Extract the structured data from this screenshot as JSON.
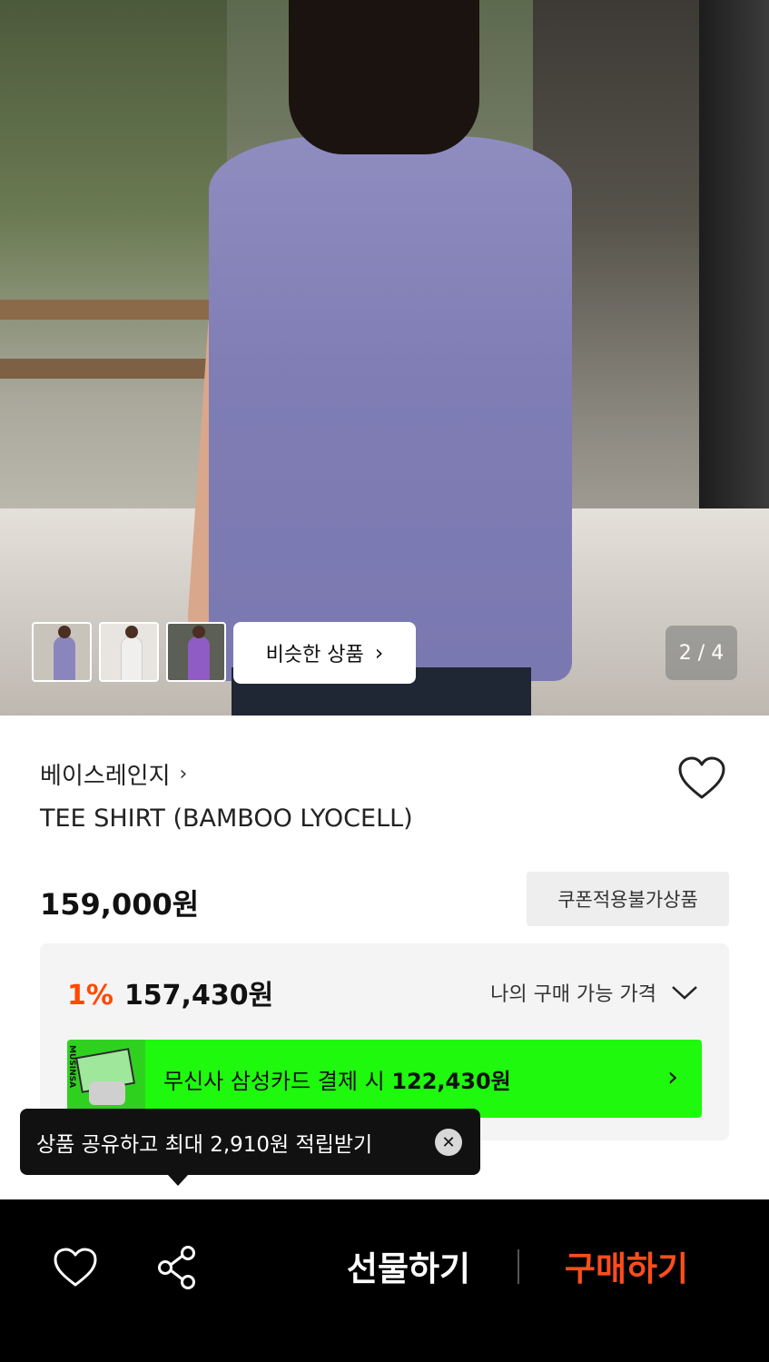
{
  "gallery": {
    "similar_label": "비슷한 상품",
    "similar_chevron": "›",
    "pager": "2 / 4",
    "thumbnails": [
      "thumb-1",
      "thumb-2",
      "thumb-3"
    ]
  },
  "product": {
    "brand": "베이스레인지",
    "brand_chevron": "›",
    "title": "TEE SHIRT (BAMBOO LYOCELL)",
    "price": "159,000원",
    "coupon_badge": "쿠폰적용불가상품"
  },
  "benefit": {
    "discount_pct": "1%",
    "discount_price": "157,430원",
    "my_price_label": "나의 구매 가능 가격",
    "card_text": "무신사 삼성카드 결제 시",
    "card_price": "122,430원",
    "card_brand": "MUSINSA",
    "card_chevron": "›"
  },
  "tooltip": {
    "text": "상품 공유하고 최대 2,910원 적립받기",
    "close": "✕"
  },
  "bottom_bar": {
    "gift_label": "선물하기",
    "buy_label": "구매하기"
  },
  "colors": {
    "accent": "#ff4800",
    "card_green": "#1ef90e",
    "bottom_bar": "#000000"
  }
}
